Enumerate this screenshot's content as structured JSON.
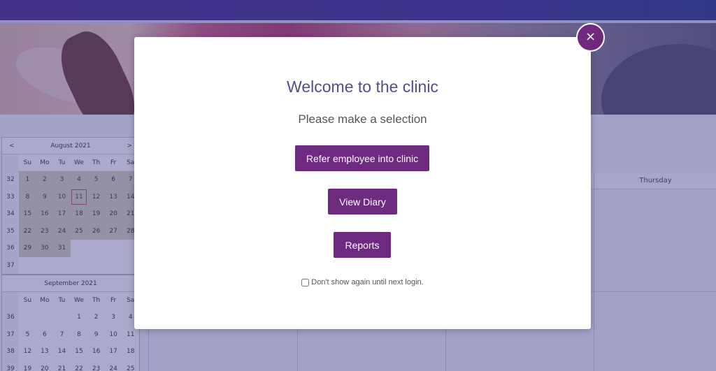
{
  "calendar": {
    "prev_label": "<",
    "next_label": ">",
    "weekday_headers": [
      "Su",
      "Mo",
      "Tu",
      "We",
      "Th",
      "Fr",
      "Sa"
    ],
    "months": [
      {
        "title": "August 2021",
        "weeks": [
          {
            "wk": "32",
            "days": [
              "1",
              "2",
              "3",
              "4",
              "5",
              "6",
              "7"
            ]
          },
          {
            "wk": "33",
            "days": [
              "8",
              "9",
              "10",
              "11",
              "12",
              "13",
              "14"
            ]
          },
          {
            "wk": "34",
            "days": [
              "15",
              "16",
              "17",
              "18",
              "19",
              "20",
              "21"
            ]
          },
          {
            "wk": "35",
            "days": [
              "22",
              "23",
              "24",
              "25",
              "26",
              "27",
              "28"
            ]
          },
          {
            "wk": "36",
            "days": [
              "29",
              "30",
              "31",
              "",
              "",
              "",
              ""
            ]
          },
          {
            "wk": "37",
            "days": [
              "",
              "",
              "",
              "",
              "",
              "",
              ""
            ]
          }
        ],
        "today": "11"
      },
      {
        "title": "September 2021",
        "weeks": [
          {
            "wk": "36",
            "days": [
              "",
              "",
              "",
              "1",
              "2",
              "3",
              "4"
            ]
          },
          {
            "wk": "37",
            "days": [
              "5",
              "6",
              "7",
              "8",
              "9",
              "10",
              "11"
            ]
          },
          {
            "wk": "38",
            "days": [
              "12",
              "13",
              "14",
              "15",
              "16",
              "17",
              "18"
            ]
          },
          {
            "wk": "39",
            "days": [
              "19",
              "20",
              "21",
              "22",
              "23",
              "24",
              "25"
            ]
          }
        ]
      }
    ]
  },
  "schedule": {
    "column_header": "Thursday"
  },
  "modal": {
    "title": "Welcome to the clinic",
    "subtitle": "Please make a selection",
    "buttons": {
      "refer": "Refer employee into clinic",
      "diary": "View Diary",
      "reports": "Reports"
    },
    "checkbox_label": "Don't show again until next login.",
    "close_label": "×"
  },
  "colors": {
    "accent": "#6e2a7f",
    "title": "#4f4f8a",
    "topbar": "#3c2f8a"
  }
}
